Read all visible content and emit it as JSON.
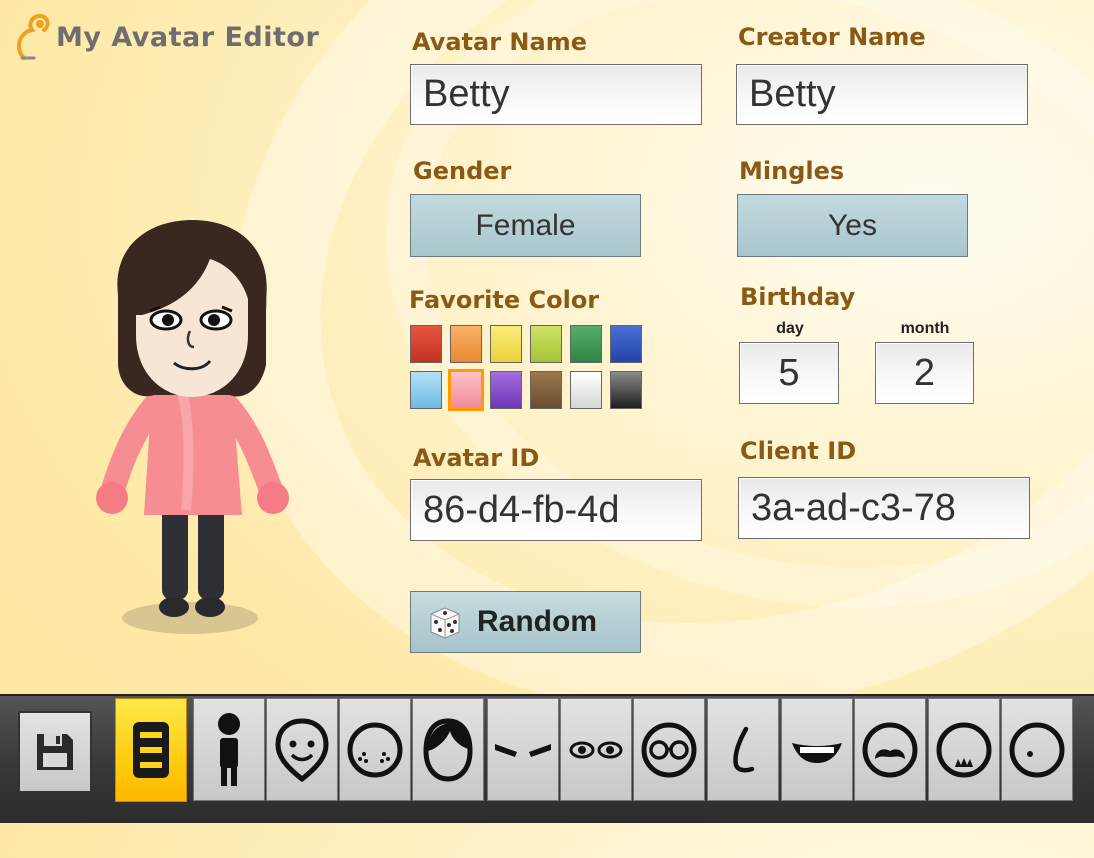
{
  "app": {
    "title": "My Avatar Editor"
  },
  "fields": {
    "avatar_name": {
      "label": "Avatar Name",
      "value": "Betty"
    },
    "creator_name": {
      "label": "Creator Name",
      "value": "Betty"
    },
    "gender": {
      "label": "Gender",
      "value": "Female"
    },
    "mingles": {
      "label": "Mingles",
      "value": "Yes"
    },
    "favorite_color": {
      "label": "Favorite Color",
      "swatches": [
        "#d9432f",
        "#f5a04d",
        "#f6e150",
        "#b9d34a",
        "#3f9a55",
        "#2f56c2",
        "#8ecdef",
        "#f7a9b0",
        "#8a4fc9",
        "#7a5a3a",
        "#f1f1f1",
        "#3e3e3e"
      ],
      "selected": "#f7a9b0"
    },
    "birthday": {
      "label": "Birthday",
      "day_label": "day",
      "month_label": "month",
      "day": "5",
      "month": "2"
    },
    "avatar_id": {
      "label": "Avatar ID",
      "value": "86-d4-fb-4d"
    },
    "client_id": {
      "label": "Client ID",
      "value": "3a-ad-c3-78"
    }
  },
  "buttons": {
    "random_label": "Random"
  },
  "toolbar": {
    "save": "save-icon",
    "tools": [
      "profile-icon",
      "body-icon",
      "face-shape-icon",
      "face-features-icon",
      "hair-icon",
      "eyebrows-icon",
      "eyes-icon",
      "glasses-icon",
      "nose-icon",
      "mouth-icon",
      "mustache-icon",
      "beard-icon",
      "mole-icon"
    ],
    "active": "profile-icon"
  },
  "colors": {
    "label": "#8a5a14",
    "accent": "#ffcc10",
    "selected_border": "#ff9a00",
    "toggle": "#b2ccd2"
  }
}
